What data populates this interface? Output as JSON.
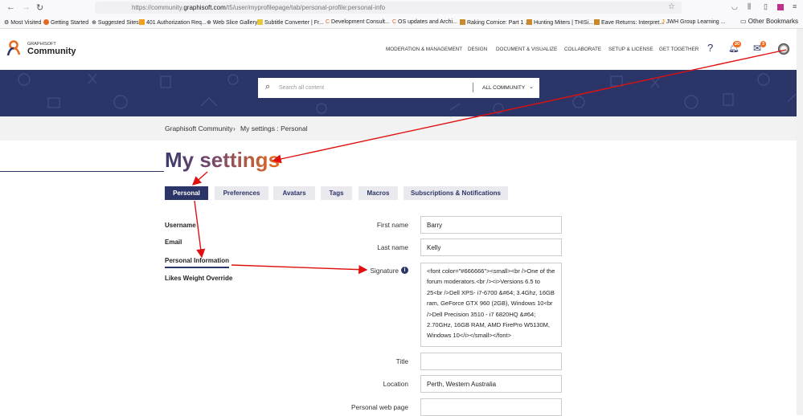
{
  "browser": {
    "url_prefix": "https://community.",
    "url_domain": "graphisoft.com",
    "url_path": "/t5/user/myprofilepage/tab/personal-profile:personal-info",
    "bookmarks": [
      "Most Visited",
      "Getting Started",
      "Suggested Sites",
      "401 Authorization Req...",
      "Web Slice Gallery",
      "Subtitle Converter | Fr...",
      "Development Consult...",
      "OS updates and Archi...",
      "Raking Cornice: Part 1 ...",
      "Hunting Miters | THISi...",
      "Eave Returns: Interpret...",
      "JWH Group Learning ..."
    ],
    "other_bookmarks": "Other Bookmarks"
  },
  "header": {
    "logo_top": "GRAPHISOFT",
    "logo_main": "Community",
    "nav": [
      "MODERATION & MANAGEMENT",
      "DESIGN",
      "DOCUMENT & VISUALIZE",
      "COLLABORATE",
      "SETUP & LICENSE",
      "GET TOGETHER"
    ],
    "notifications_count": "20",
    "messages_count": "3"
  },
  "search": {
    "placeholder": "Search all content",
    "scope": "ALL COMMUNITY"
  },
  "breadcrumb": {
    "home": "Graphisoft Community",
    "sep": "›",
    "current": "My settings : Personal"
  },
  "page_title": "My settings",
  "tabs": [
    "Personal",
    "Preferences",
    "Avatars",
    "Tags",
    "Macros",
    "Subscriptions & Notifications"
  ],
  "side": [
    "Username",
    "Email",
    "Personal Information",
    "Likes Weight Override"
  ],
  "form": {
    "first_name": {
      "label": "First name",
      "value": "Barry"
    },
    "last_name": {
      "label": "Last name",
      "value": "Kelly"
    },
    "signature": {
      "label": "Signature",
      "value": "<font color=\"#666666\"><small><br />One of the forum moderators.<br /><i>Versions 6.5 to 25<br />Dell XPS- i7-6700 &#64; 3.4Ghz, 16GB ram, GeForce GTX 960 (2GB), Windows 10<br />Dell Precision 3510 - i7 6820HQ &#64; 2.70GHz, 16GB RAM, AMD FirePro W5130M, Windows 10</i></small></font>"
    },
    "title": {
      "label": "Title",
      "value": ""
    },
    "location": {
      "label": "Location",
      "value": "Perth, Western Australia"
    },
    "web_page": {
      "label": "Personal web page",
      "value": ""
    }
  },
  "colors": {
    "navy": "#2c3567",
    "accent": "#e76b1e",
    "arrow": "#e01010"
  }
}
